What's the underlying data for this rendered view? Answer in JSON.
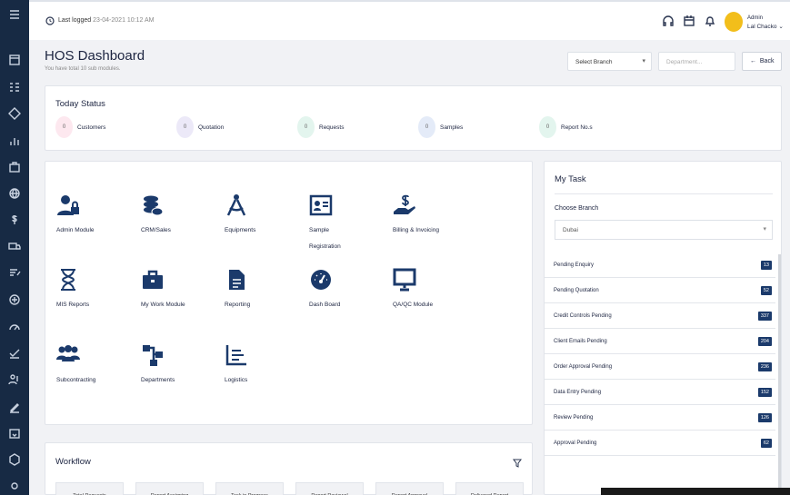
{
  "header": {
    "last_logged_label": "Last logged",
    "last_logged_value": "23-04-2021 10:12 AM",
    "user_role": "Admin",
    "user_name": "Lal Chacko ⌄"
  },
  "page": {
    "title": "HOS Dashboard",
    "subtitle": "You have total 10 sub modules.",
    "branch_select": "Select Branch",
    "department_placeholder": "Department...",
    "back_label": "Back"
  },
  "today": {
    "title": "Today Status",
    "stats": [
      {
        "value": "0",
        "label": "Customers",
        "color": "#fde8ef"
      },
      {
        "value": "0",
        "label": "Quotation",
        "color": "#ece9f8"
      },
      {
        "value": "0",
        "label": "Requests",
        "color": "#e3f5ee"
      },
      {
        "value": "0",
        "label": "Samples",
        "color": "#e4ebf8"
      },
      {
        "value": "0",
        "label": "Report No.s",
        "color": "#e3f5ee"
      }
    ]
  },
  "modules": [
    {
      "label": "Admin Module",
      "icon": "user-lock-icon"
    },
    {
      "label": "CRM/Sales",
      "icon": "coins-icon"
    },
    {
      "label": "Equipments",
      "icon": "compass-icon"
    },
    {
      "label": "Sample",
      "label2": "Registration",
      "icon": "id-card-icon"
    },
    {
      "label": "Billing & Invoicing",
      "icon": "hand-dollar-icon"
    },
    {
      "label": "MIS Reports",
      "icon": "hourglass-icon"
    },
    {
      "label": "My Work Module",
      "icon": "briefcase-icon"
    },
    {
      "label": "Reporting",
      "icon": "file-icon"
    },
    {
      "label": "Dash Board",
      "icon": "gauge-icon"
    },
    {
      "label": "QA/QC Module",
      "icon": "monitor-icon"
    },
    {
      "label": "Subcontracting",
      "icon": "users-icon"
    },
    {
      "label": "Departments",
      "icon": "sitemap-icon"
    },
    {
      "label": "Logistics",
      "icon": "chart-lines-icon"
    }
  ],
  "task": {
    "title": "My Task",
    "choose_branch": "Choose Branch",
    "branch_value": "Dubai",
    "items": [
      {
        "label": "Pending Enquiry",
        "count": "13"
      },
      {
        "label": "Pending Quotation",
        "count": "52"
      },
      {
        "label": "Credit Controls Pending",
        "count": "337"
      },
      {
        "label": "Client Emails Pending",
        "count": "204"
      },
      {
        "label": "Order Approval Pending",
        "count": "236"
      },
      {
        "label": "Data Entry Pending",
        "count": "152"
      },
      {
        "label": "Review Pending",
        "count": "126"
      },
      {
        "label": "Approval Pending",
        "count": "62"
      }
    ]
  },
  "workflow": {
    "title": "Workflow",
    "boxes": [
      "Total Requests",
      "Report Assigning",
      "Task in Progress",
      "Report Reviewal",
      "Report Approval",
      "Delivered Report"
    ]
  },
  "colors": {
    "sidebar": "#172a44",
    "accent": "#1b3a6b",
    "avatar": "#f2be1b"
  }
}
